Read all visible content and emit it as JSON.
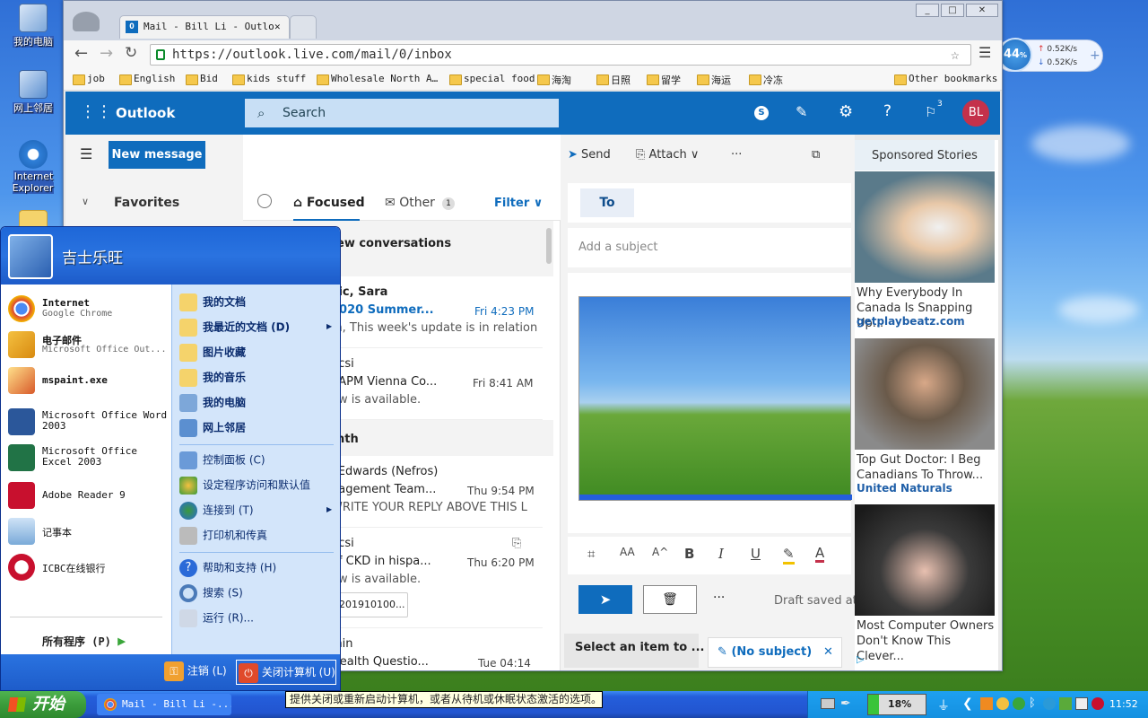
{
  "desktop": {
    "icons": [
      {
        "label": "我的电脑",
        "icon": "my-computer-icon"
      },
      {
        "label": "网上邻居",
        "icon": "network-places-icon"
      },
      {
        "label": "Internet Explorer",
        "icon": "internet-explorer-icon"
      }
    ]
  },
  "browser": {
    "tab_title": "Mail - Bill Li - Outlo",
    "url": "https://outlook.live.com/mail/0/inbox",
    "window_buttons": [
      "_",
      "□",
      "✕"
    ],
    "bookmarks": [
      "job",
      "English",
      "Bid",
      "kids stuff",
      "Wholesale North A…",
      "special food",
      "海淘",
      "日照",
      "留学",
      "海运",
      "冷冻"
    ],
    "other_bookmarks": "Other bookmarks"
  },
  "netwidget": {
    "percent": "44",
    "up": "0.52K/s",
    "down": "0.52K/s",
    "plus": "+"
  },
  "outlook": {
    "app_name": "Outlook",
    "search_placeholder": "Search",
    "notification_count": "3",
    "avatar_initials": "BL",
    "new_message": "New message",
    "favorites": "Favorites",
    "tabs": {
      "focused": "Focused",
      "other": "Other",
      "other_count": "1",
      "filter": "Filter"
    },
    "toolbar": {
      "send": "Send",
      "attach": "Attach",
      "more": "···"
    },
    "mail_rows": [
      {
        "header": "ew conversations"
      },
      {
        "sender": "vic, Sara",
        "subject": "2020 Summer...",
        "time": "Fri 4:23 PM",
        "preview": "m, This week's update is in relation"
      },
      {
        "sender": "ucsi",
        "subject": "EAPM Vienna Co...",
        "time": "Fri 8:41 AM",
        "preview": "ew is available."
      },
      {
        "header": "nth"
      },
      {
        "sender": "l Edwards (Nefros)",
        "subject": "nagement Team...",
        "time": "Thu 9:54 PM",
        "preview": "WRITE YOUR REPLY ABOVE THIS L"
      },
      {
        "sender": "ucsi",
        "subject": "of CKD in hispa...",
        "time": "Thu 6:20 PM",
        "preview": "ew is available.",
        "attachment": "201910100..."
      },
      {
        "sender": "min",
        "subject": "Health Questio...",
        "time": "Tue 04:14"
      }
    ],
    "compose": {
      "to": "To",
      "subject_placeholder": "Add a subject",
      "draft_status": "Draft saved at",
      "more": "···",
      "format_buttons": [
        "B",
        "I",
        "U",
        "A"
      ]
    },
    "bottom": {
      "select_item": "Select an item to ...",
      "no_subject": "(No subject)"
    }
  },
  "ads": {
    "header": "Sponsored Stories",
    "items": [
      {
        "title": "Why Everybody In Canada Is Snapping Up...",
        "source": "getplaybeatz.com"
      },
      {
        "title": "Top Gut Doctor: I Beg Canadians To Throw...",
        "source": "United Naturals"
      },
      {
        "title": "Most Computer Owners Don't Know This Clever...",
        "source": ""
      }
    ]
  },
  "start_menu": {
    "user": "吉士乐旺",
    "pinned": [
      {
        "name": "Internet",
        "sub": "Google Chrome"
      },
      {
        "name": "电子邮件",
        "sub": "Microsoft Office Out..."
      },
      {
        "name": "mspaint.exe",
        "sub": ""
      },
      {
        "name": "Microsoft Office Word 2003",
        "sub": ""
      },
      {
        "name": "Microsoft Office Excel 2003",
        "sub": ""
      },
      {
        "name": "Adobe Reader 9",
        "sub": ""
      },
      {
        "name": "记事本",
        "sub": ""
      },
      {
        "name": "ICBC在线银行",
        "sub": ""
      }
    ],
    "all_programs": "所有程序 (P)",
    "right": [
      "我的文档",
      "我最近的文档 (D)",
      "图片收藏",
      "我的音乐",
      "我的电脑",
      "网上邻居",
      "控制面板 (C)",
      "设定程序访问和默认值",
      "连接到 (T)",
      "打印机和传真",
      "帮助和支持 (H)",
      "搜索 (S)",
      "运行 (R)..."
    ],
    "logoff": "注销 (L)",
    "shutdown": "关闭计算机 (U)"
  },
  "taskbar": {
    "start": "开始",
    "task": "Mail - Bill Li -...",
    "tooltip": "提供关闭或重新启动计算机，或者从待机或休眠状态激活的选项。",
    "battery": "18%",
    "clock": "11:52"
  }
}
